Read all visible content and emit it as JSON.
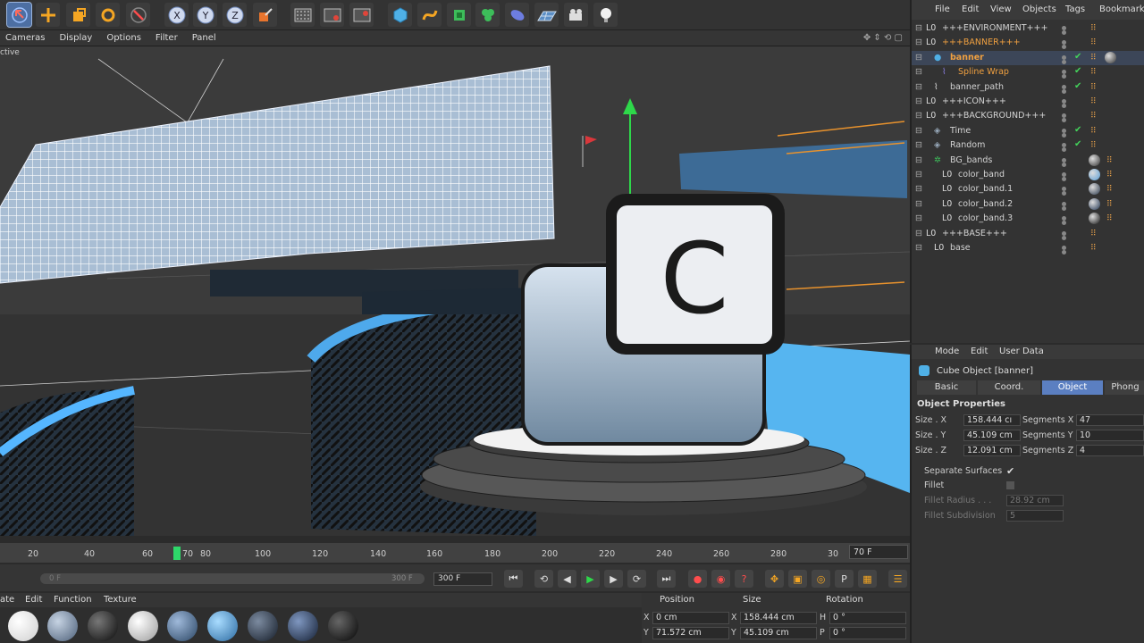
{
  "toolbar": {
    "axes": [
      "X",
      "Y",
      "Z"
    ],
    "icons": [
      "move-arrow-icon",
      "move-cross-icon",
      "scale-box-icon",
      "rotate-icon",
      "undo-arrow-icon",
      "x-axis-icon",
      "y-axis-icon",
      "z-axis-icon",
      "coordinate-system-icon",
      "render-view-icon",
      "render-picture-icon",
      "render-settings-icon",
      "cube-icon",
      "spline-icon",
      "subdivision-icon",
      "array-icon",
      "deformer-icon",
      "floor-icon",
      "camera-icon",
      "light-icon"
    ]
  },
  "viewport": {
    "menu": [
      "Cameras",
      "Display",
      "Options",
      "Filter",
      "Panel"
    ],
    "label": "ctive",
    "key_overlay": "C"
  },
  "timeline": {
    "ticks": [
      "20",
      "40",
      "60",
      "70",
      "80",
      "100",
      "120",
      "140",
      "160",
      "180",
      "200",
      "220",
      "240",
      "260",
      "280",
      "30"
    ],
    "current_frame": "70 F",
    "slider_start": "0 F",
    "slider_end": "300 F",
    "end_field": "300 F"
  },
  "materials": {
    "menu": [
      "ate",
      "Edit",
      "Function",
      "Texture"
    ],
    "swatches": [
      "#f4f4f4",
      "#7a8fa8",
      "#1c1c1c",
      "#c8c8c8",
      "#4f6f95",
      "#5a9ed6",
      "#2c3a4d",
      "#243754",
      "#151515"
    ]
  },
  "coordinates": {
    "headers": [
      "Position",
      "Size",
      "Rotation"
    ],
    "rows": [
      {
        "axis": "X",
        "pos": "0 cm",
        "size_axis": "X",
        "size": "158.444 cm",
        "rot_axis": "H",
        "rot": "0 °"
      },
      {
        "axis": "Y",
        "pos": "71.572 cm",
        "size_axis": "Y",
        "size": "45.109 cm",
        "rot_axis": "P",
        "rot": "0 °"
      }
    ]
  },
  "object_manager": {
    "menu": [
      "File",
      "Edit",
      "View",
      "Objects",
      "Tags",
      "Bookmarks"
    ],
    "rows": [
      {
        "name": "+++ENVIRONMENT+++",
        "indent": 0,
        "kind": "null"
      },
      {
        "name": "+++BANNER+++",
        "indent": 0,
        "kind": "null-orange"
      },
      {
        "name": "banner",
        "indent": 1,
        "kind": "cube-sel"
      },
      {
        "name": "Spline Wrap",
        "indent": 2,
        "kind": "deformer-orange"
      },
      {
        "name": "banner_path",
        "indent": 1,
        "kind": "spline"
      },
      {
        "name": "+++ICON+++",
        "indent": 0,
        "kind": "null"
      },
      {
        "name": "+++BACKGROUND+++",
        "indent": 0,
        "kind": "null"
      },
      {
        "name": "Time",
        "indent": 1,
        "kind": "effector"
      },
      {
        "name": "Random",
        "indent": 1,
        "kind": "effector"
      },
      {
        "name": "BG_bands",
        "indent": 1,
        "kind": "cloner"
      },
      {
        "name": "color_band",
        "indent": 2,
        "kind": "null"
      },
      {
        "name": "color_band.1",
        "indent": 2,
        "kind": "null"
      },
      {
        "name": "color_band.2",
        "indent": 2,
        "kind": "null"
      },
      {
        "name": "color_band.3",
        "indent": 2,
        "kind": "null"
      },
      {
        "name": "+++BASE+++",
        "indent": 0,
        "kind": "null"
      },
      {
        "name": "base",
        "indent": 1,
        "kind": "null"
      }
    ]
  },
  "attributes": {
    "menu": [
      "Mode",
      "Edit",
      "User Data"
    ],
    "title": "Cube Object [banner]",
    "tabs": [
      "Basic",
      "Coord.",
      "Object",
      "Phong"
    ],
    "active_tab": "Object",
    "section": "Object Properties",
    "size_x_label": "Size . X",
    "size_x": "158.444 cı",
    "size_y_label": "Size . Y",
    "size_y": "45.109 cm",
    "size_z_label": "Size . Z",
    "size_z": "12.091 cm",
    "seg_x_label": "Segments X",
    "seg_x": "47",
    "seg_y_label": "Segments Y",
    "seg_y": "10",
    "seg_z_label": "Segments Z",
    "seg_z": "4",
    "separate_label": "Separate Surfaces",
    "fillet_label": "Fillet",
    "fillet_radius_label": "Fillet Radius . . .",
    "fillet_radius": "28.92 cm",
    "fillet_sub_label": "Fillet Subdivision",
    "fillet_sub": "5"
  }
}
